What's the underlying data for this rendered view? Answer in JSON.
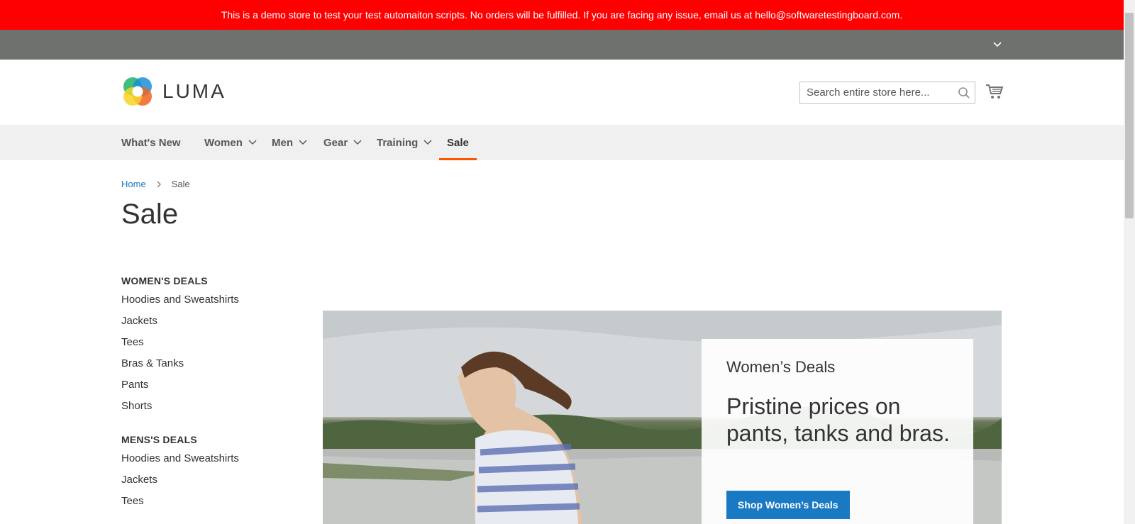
{
  "notice": "This is a demo store to test your test automaiton scripts. No orders will be fulfilled. If you are facing any issue, email us at hello@softwaretestingboard.com.",
  "logo": {
    "text": "LUMA"
  },
  "search": {
    "placeholder": "Search entire store here..."
  },
  "nav": {
    "items": [
      {
        "label": "What's New"
      },
      {
        "label": "Women"
      },
      {
        "label": "Men"
      },
      {
        "label": "Gear"
      },
      {
        "label": "Training"
      },
      {
        "label": "Sale"
      }
    ]
  },
  "breadcrumb": {
    "home": "Home",
    "current": "Sale"
  },
  "page_title": "Sale",
  "sidebar": {
    "womens": {
      "title": "WOMEN'S DEALS",
      "items": [
        "Hoodies and Sweatshirts",
        "Jackets",
        "Tees",
        "Bras & Tanks",
        "Pants",
        "Shorts"
      ]
    },
    "mens": {
      "title": "MENS'S DEALS",
      "items": [
        "Hoodies and Sweatshirts",
        "Jackets",
        "Tees"
      ]
    }
  },
  "promo": {
    "eyebrow": "Women’s Deals",
    "headline": "Pristine prices on pants, tanks and bras.",
    "button": "Shop Women’s Deals"
  },
  "colors": {
    "notice_bg": "#ff0000",
    "panel_bg": "#6e716e",
    "nav_bg": "#f0f0f0",
    "active_underline": "#ff5501",
    "link": "#1979c3",
    "button": "#1979c3"
  }
}
